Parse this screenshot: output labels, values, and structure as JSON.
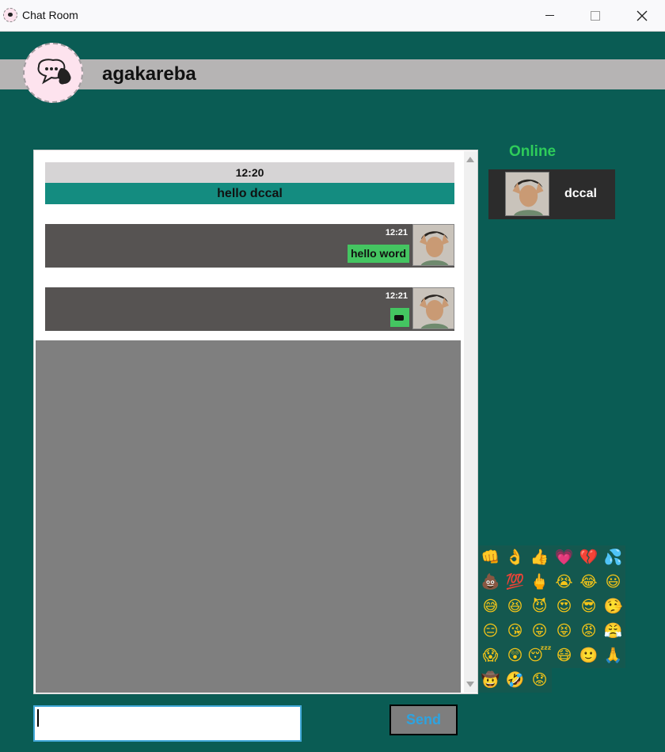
{
  "window": {
    "title": "Chat Room"
  },
  "header": {
    "username": "agakareba",
    "logo_icon": "chat-bubble-logo-icon"
  },
  "chat": {
    "time_separator": "12:20",
    "group_message": "hello dccal",
    "messages": [
      {
        "time": "12:21",
        "text": "hello word",
        "type": "text"
      },
      {
        "time": "12:21",
        "type": "sticker",
        "icon": "sticker-icon"
      }
    ]
  },
  "online": {
    "label": "Online",
    "users": [
      {
        "name": "dccal"
      }
    ]
  },
  "emojis": [
    "👊",
    "👌",
    "👍",
    "💗",
    "💔",
    "💦",
    "💩",
    "💯",
    "🖕",
    "😭",
    "😂",
    "😃",
    "😅",
    "😆",
    "😈",
    "😍",
    "😎",
    "🤥",
    "😑",
    "😘",
    "😛",
    "😝",
    "😡",
    "😤",
    "😱",
    "😲",
    "😴",
    "😷",
    "🙂",
    "🙏",
    "🤠",
    "🤣",
    "😟"
  ],
  "input": {
    "value": "",
    "placeholder": ""
  },
  "send": {
    "label": "Send"
  },
  "colors": {
    "background": "#0a5c54",
    "online_green": "#2ecc5a",
    "bubble_green": "#44c561",
    "send_text": "#2ea3e0",
    "message_teal": "#148c80"
  }
}
